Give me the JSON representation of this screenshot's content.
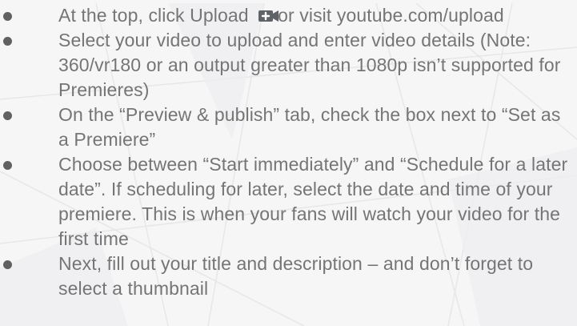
{
  "steps": [
    {
      "before_icon": "At the top, click Upload ",
      "icon": "video-upload-icon",
      "after_icon": "or visit youtube.com/upload"
    },
    {
      "text": "Select your video to upload and enter video details (Note: 360/vr180 or an output greater than 1080p isn’t supported for Premieres)"
    },
    {
      "text": "On the “Preview & publish” tab, check the box next to “Set as a Premiere”"
    },
    {
      "text": "Choose between “Start immediately” and “Schedule for a later date”. If scheduling for later, select the date and time of your premiere. This is when your fans will watch your video for the first time"
    },
    {
      "text": "Next, fill out your title and description – and don’t forget to select a thumbnail"
    }
  ],
  "colors": {
    "text": "#757575",
    "bullet": "#616161",
    "background": "#f6f6f7",
    "icon": "#5f6368"
  }
}
